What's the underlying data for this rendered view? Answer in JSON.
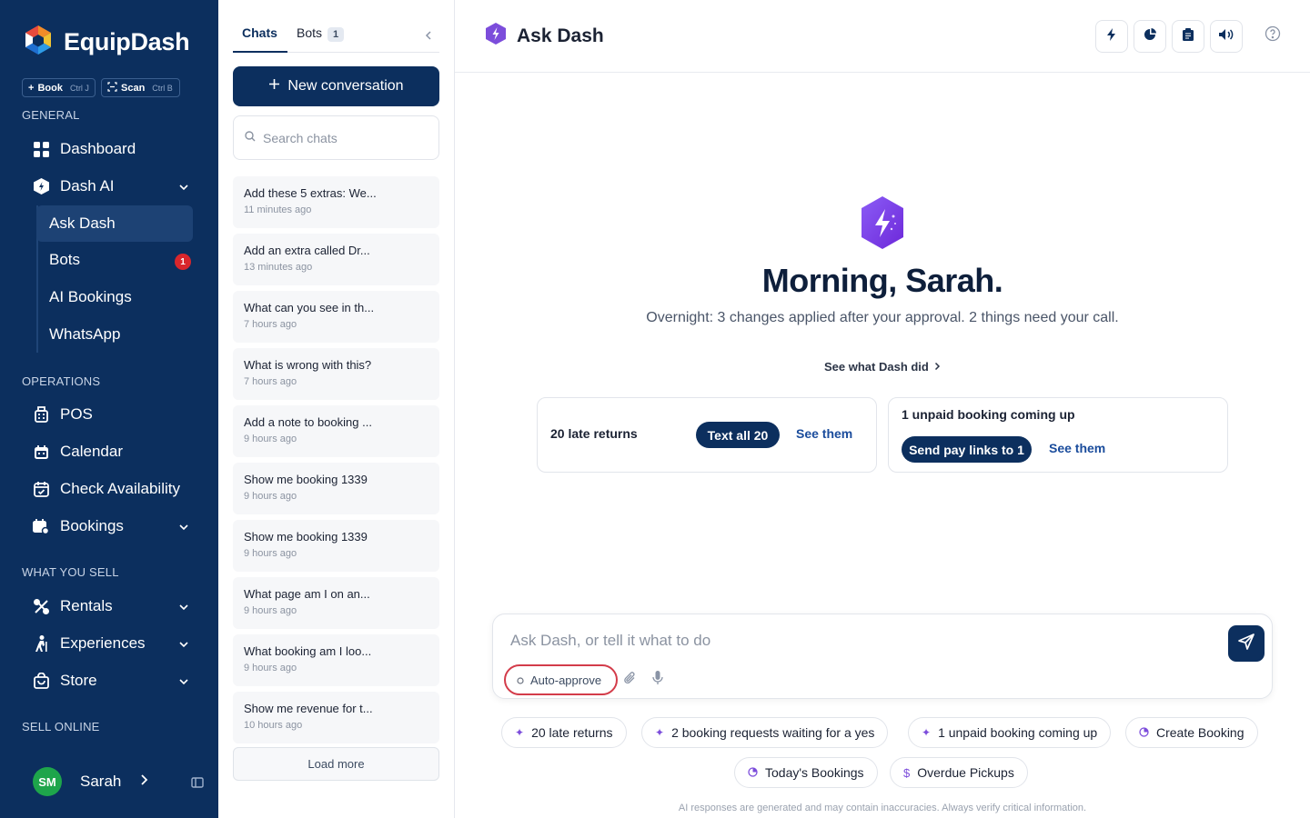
{
  "app": {
    "name": "EquipDash"
  },
  "quick_actions": [
    {
      "label": "Book",
      "shortcut": "Ctrl J"
    },
    {
      "label": "Scan",
      "shortcut": "Ctrl B"
    }
  ],
  "sidebar": {
    "sections": {
      "general": "GENERAL",
      "operations": "OPERATIONS",
      "what_you_sell": "WHAT YOU SELL",
      "sell_online": "SELL ONLINE"
    },
    "items": {
      "dashboard": "Dashboard",
      "dash_ai": "Dash AI",
      "pos": "POS",
      "calendar": "Calendar",
      "check_availability": "Check Availability",
      "bookings": "Bookings",
      "rentals": "Rentals",
      "experiences": "Experiences",
      "store": "Store"
    },
    "dash_ai_sub": {
      "ask_dash": "Ask Dash",
      "bots": "Bots",
      "bots_badge": "1",
      "ai_bookings": "AI Bookings",
      "whatsapp": "WhatsApp"
    },
    "user": {
      "initials": "SM",
      "name": "Sarah"
    }
  },
  "chat_panel": {
    "tabs": {
      "chats": "Chats",
      "bots": "Bots",
      "bots_count": "1"
    },
    "new_conversation": "New conversation",
    "search_placeholder": "Search chats",
    "chats": [
      {
        "title": "Add these 5 extras: We...",
        "time": "11 minutes ago"
      },
      {
        "title": "Add an extra called Dr...",
        "time": "13 minutes ago"
      },
      {
        "title": "What can you see in th...",
        "time": "7 hours ago"
      },
      {
        "title": "What is wrong with this?",
        "time": "7 hours ago"
      },
      {
        "title": "Add a note to booking ...",
        "time": "9 hours ago"
      },
      {
        "title": "Show me booking 1339",
        "time": "9 hours ago"
      },
      {
        "title": "Show me booking 1339",
        "time": "9 hours ago"
      },
      {
        "title": "What page am I on an...",
        "time": "9 hours ago"
      },
      {
        "title": "What booking am I loo...",
        "time": "9 hours ago"
      },
      {
        "title": "Show me revenue for t...",
        "time": "10 hours ago"
      }
    ],
    "load_more": "Load more"
  },
  "main": {
    "title": "Ask Dash",
    "greeting": "Morning, Sarah.",
    "summary": "Overnight: 3 changes applied after your approval. 2 things need your call.",
    "see_what": "See what Dash did",
    "cards": {
      "late": {
        "title": "20 late returns",
        "action": "Text all 20",
        "link": "See them"
      },
      "unpaid": {
        "title": "1 unpaid booking coming up",
        "action": "Send pay links to 1",
        "link": "See them"
      }
    },
    "composer": {
      "placeholder": "Ask Dash, or tell it what to do",
      "auto_approve": "Auto-approve"
    },
    "suggestions": {
      "late": "20 late returns",
      "requests": "2 booking requests waiting for a yes",
      "unpaid": "1 unpaid booking coming up",
      "create": "Create Booking",
      "today": "Today's Bookings",
      "overdue": "Overdue Pickups"
    },
    "disclaimer": "AI responses are generated and may contain inaccuracies. Always verify critical information."
  },
  "colors": {
    "navy": "#0c2f5e",
    "accent_purple": "#7c4ddb",
    "alert_red": "#d9262c",
    "avatar_green": "#1ea54b"
  }
}
